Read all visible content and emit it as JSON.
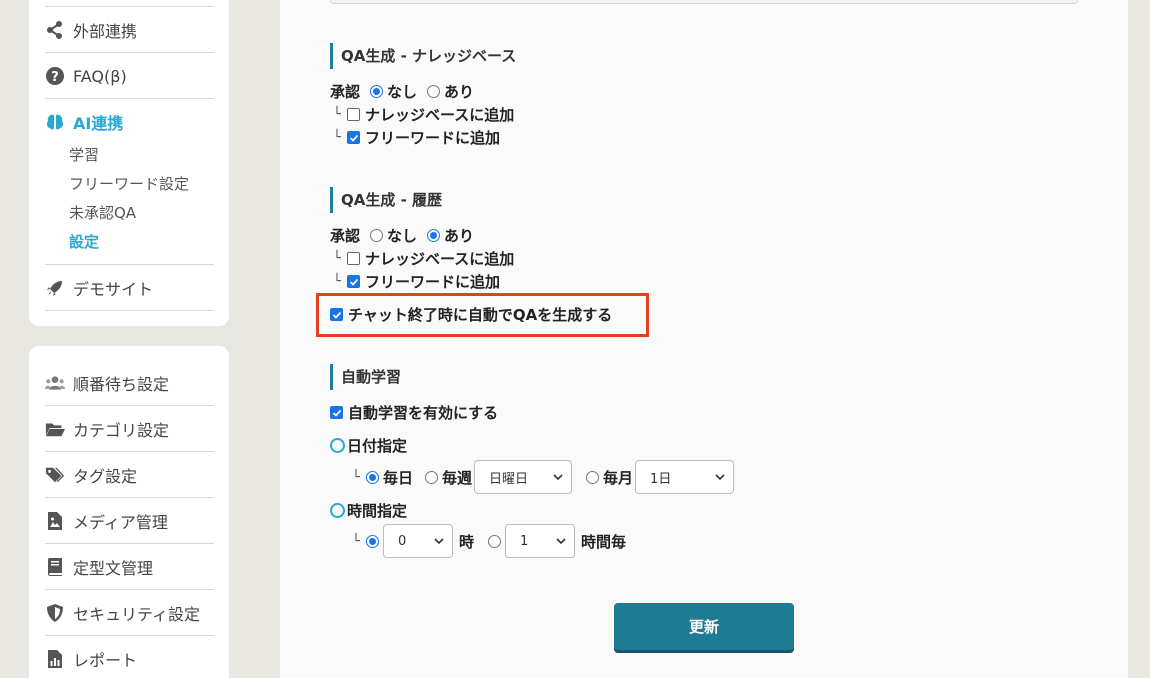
{
  "sidebar": {
    "top_items": [
      {
        "label": "外部連携",
        "icon": "share-icon"
      },
      {
        "label": "FAQ(β)",
        "icon": "question-circle-icon"
      },
      {
        "label": "AI連携",
        "icon": "brain-icon",
        "active": true
      },
      {
        "label": "デモサイト",
        "icon": "rocket-icon"
      }
    ],
    "ai_sub_items": [
      "学習",
      "フリーワード設定",
      "未承認QA",
      "設定"
    ],
    "bottom_items": [
      {
        "label": "順番待ち設定",
        "icon": "users-icon"
      },
      {
        "label": "カテゴリ設定",
        "icon": "folder-open-icon"
      },
      {
        "label": "タグ設定",
        "icon": "tags-icon"
      },
      {
        "label": "メディア管理",
        "icon": "image-file-icon"
      },
      {
        "label": "定型文管理",
        "icon": "book-icon"
      },
      {
        "label": "セキュリティ設定",
        "icon": "shield-icon"
      },
      {
        "label": "レポート",
        "icon": "chart-file-icon"
      }
    ],
    "active_color": "#29a8d6"
  },
  "qa_knowledge": {
    "title": "QA生成 - ナレッジベース",
    "approval_label": "承認",
    "option_none": "なし",
    "option_yes": "あり",
    "selected": "none",
    "add_knowledge": "ナレッジベースに追加",
    "add_knowledge_checked": false,
    "add_freeword": "フリーワードに追加",
    "add_freeword_checked": true
  },
  "qa_history": {
    "title": "QA生成 - 履歴",
    "approval_label": "承認",
    "option_none": "なし",
    "option_yes": "あり",
    "selected": "yes",
    "add_knowledge": "ナレッジベースに追加",
    "add_knowledge_checked": false,
    "add_freeword": "フリーワードに追加",
    "add_freeword_checked": true,
    "auto_generate": "チャット終了時に自動でQAを生成する",
    "auto_generate_checked": true
  },
  "auto_learning": {
    "title": "自動学習",
    "enable_label": "自動学習を有効にする",
    "enable_checked": true,
    "date_spec": "日付指定",
    "daily": "毎日",
    "weekly": "毎週",
    "weekday_value": "日曜日",
    "monthly": "毎月",
    "monthday_value": "1日",
    "time_spec": "時間指定",
    "hour_value": "0",
    "hour_unit": "時",
    "interval_value": "1",
    "interval_unit": "時間毎"
  },
  "update_button": "更新",
  "colors": {
    "accent": "#1e7b94",
    "highlight": "#e5401c",
    "radio": "#1a73e8"
  }
}
